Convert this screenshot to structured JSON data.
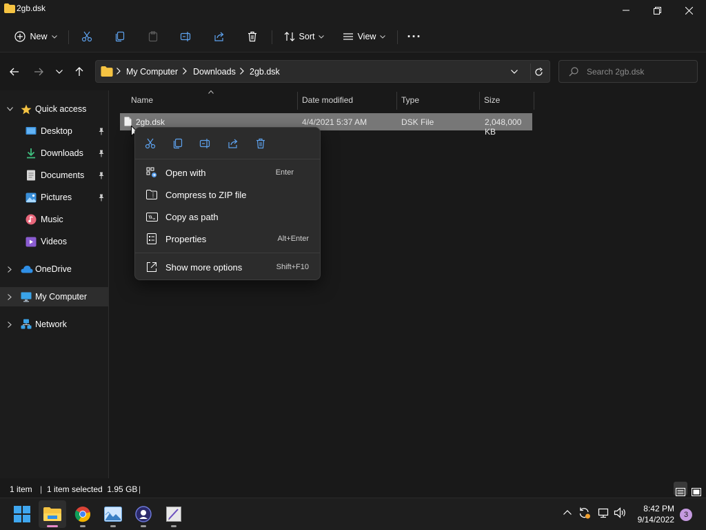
{
  "window": {
    "title": "2gb.dsk"
  },
  "toolbar": {
    "new_label": "New",
    "sort_label": "Sort",
    "view_label": "View",
    "more_label": "···"
  },
  "address": {
    "breadcrumbs": [
      "My Computer",
      "Downloads",
      "2gb.dsk"
    ],
    "search_placeholder": "Search 2gb.dsk"
  },
  "sidebar": {
    "quick_access": "Quick access",
    "items": [
      {
        "label": "Desktop",
        "icon": "desktop-icon",
        "pinned": true
      },
      {
        "label": "Downloads",
        "icon": "downloads-icon",
        "pinned": true
      },
      {
        "label": "Documents",
        "icon": "documents-icon",
        "pinned": true
      },
      {
        "label": "Pictures",
        "icon": "pictures-icon",
        "pinned": true
      },
      {
        "label": "Music",
        "icon": "music-icon",
        "pinned": false
      },
      {
        "label": "Videos",
        "icon": "videos-icon",
        "pinned": false
      }
    ],
    "onedrive": "OneDrive",
    "my_computer": "My Computer",
    "network": "Network"
  },
  "columns": {
    "name": "Name",
    "date": "Date modified",
    "type": "Type",
    "size": "Size"
  },
  "files": [
    {
      "name": "2gb.dsk",
      "date": "4/4/2021 5:37 AM",
      "type": "DSK File",
      "size": "2,048,000 KB"
    }
  ],
  "context_menu": {
    "quick_actions": [
      "cut-icon",
      "copy-icon",
      "rename-icon",
      "share-icon",
      "delete-icon"
    ],
    "items": [
      {
        "label": "Open with",
        "shortcut": "Enter"
      },
      {
        "label": "Compress to ZIP file",
        "shortcut": ""
      },
      {
        "label": "Copy as path",
        "shortcut": ""
      },
      {
        "label": "Properties",
        "shortcut": "Alt+Enter"
      }
    ],
    "more": {
      "label": "Show more options",
      "shortcut": "Shift+F10"
    }
  },
  "status": {
    "count": "1 item",
    "selection": "1 item selected  1.95 GB"
  },
  "taskbar": {
    "time": "8:42 PM",
    "date": "9/14/2022",
    "notifications": "3"
  },
  "colors": {
    "accent": "#0067c0",
    "folder": "#f5c342",
    "selection": "#777777"
  }
}
